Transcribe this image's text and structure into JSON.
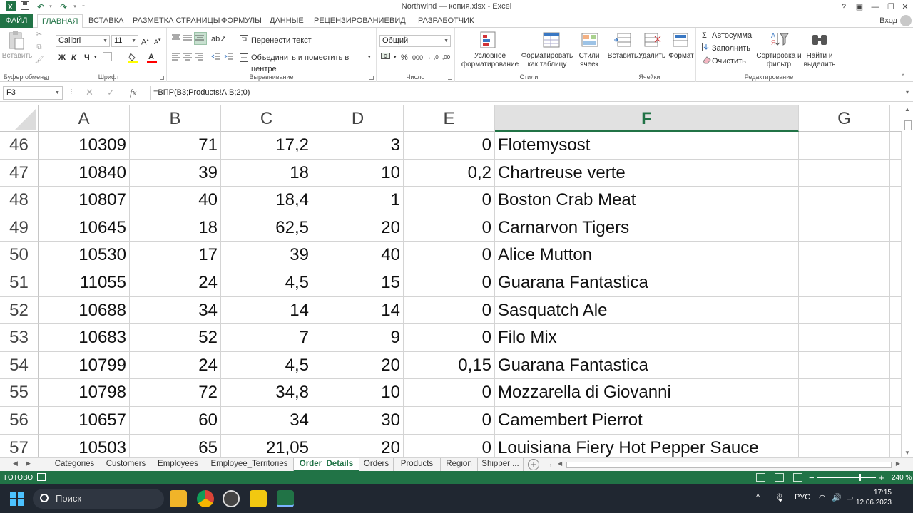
{
  "window": {
    "title": "Northwind — копия.xlsx - Excel",
    "help": "?",
    "login": "Вход"
  },
  "tabs": [
    "ФАЙЛ",
    "ГЛАВНАЯ",
    "ВСТАВКА",
    "РАЗМЕТКА СТРАНИЦЫ",
    "ФОРМУЛЫ",
    "ДАННЫЕ",
    "РЕЦЕНЗИРОВАНИЕ",
    "ВИД",
    "РАЗРАБОТЧИК"
  ],
  "ribbon": {
    "clipboard": {
      "label": "Буфер обмена",
      "paste": "Вставить"
    },
    "font": {
      "label": "Шрифт",
      "name": "Calibri",
      "size": "11",
      "bold": "Ж",
      "italic": "К",
      "underline": "Ч"
    },
    "alignment": {
      "label": "Выравнивание",
      "wrap": "Перенести текст",
      "merge": "Объединить и поместить в центре"
    },
    "number": {
      "label": "Число",
      "format": "Общий",
      "percent": "%",
      "thousands": "000"
    },
    "styles": {
      "label": "Стили",
      "conditional": "Условное форматирование",
      "as_table": "Форматировать как таблицу",
      "cell_styles": "Стили ячеек"
    },
    "cells": {
      "label": "Ячейки",
      "insert": "Вставить",
      "delete": "Удалить",
      "format": "Формат"
    },
    "editing": {
      "label": "Редактирование",
      "autosum": "Автосумма",
      "fill": "Заполнить",
      "clear": "Очистить",
      "sort": "Сортировка и фильтр",
      "find": "Найти и выделить"
    }
  },
  "formula_bar": {
    "name_box": "F3",
    "fx": "fx",
    "formula": "=ВПР(B3;Products!A:B;2;0)"
  },
  "columns": [
    "A",
    "B",
    "C",
    "D",
    "E",
    "F",
    "G"
  ],
  "rows": [
    {
      "n": "46",
      "a": "10309",
      "b": "71",
      "c": "17,2",
      "d": "3",
      "e": "0",
      "f": "Flotemysost"
    },
    {
      "n": "47",
      "a": "10840",
      "b": "39",
      "c": "18",
      "d": "10",
      "e": "0,2",
      "f": "Chartreuse verte"
    },
    {
      "n": "48",
      "a": "10807",
      "b": "40",
      "c": "18,4",
      "d": "1",
      "e": "0",
      "f": "Boston Crab Meat"
    },
    {
      "n": "49",
      "a": "10645",
      "b": "18",
      "c": "62,5",
      "d": "20",
      "e": "0",
      "f": "Carnarvon Tigers"
    },
    {
      "n": "50",
      "a": "10530",
      "b": "17",
      "c": "39",
      "d": "40",
      "e": "0",
      "f": "Alice Mutton"
    },
    {
      "n": "51",
      "a": "11055",
      "b": "24",
      "c": "4,5",
      "d": "15",
      "e": "0",
      "f": "Guarana Fantastica"
    },
    {
      "n": "52",
      "a": "10688",
      "b": "34",
      "c": "14",
      "d": "14",
      "e": "0",
      "f": "Sasquatch Ale"
    },
    {
      "n": "53",
      "a": "10683",
      "b": "52",
      "c": "7",
      "d": "9",
      "e": "0",
      "f": "Filo Mix"
    },
    {
      "n": "54",
      "a": "10799",
      "b": "24",
      "c": "4,5",
      "d": "20",
      "e": "0,15",
      "f": "Guarana Fantastica"
    },
    {
      "n": "55",
      "a": "10798",
      "b": "72",
      "c": "34,8",
      "d": "10",
      "e": "0",
      "f": "Mozzarella di Giovanni"
    },
    {
      "n": "56",
      "a": "10657",
      "b": "60",
      "c": "34",
      "d": "30",
      "e": "0",
      "f": "Camembert Pierrot"
    },
    {
      "n": "57",
      "a": "10503",
      "b": "65",
      "c": "21,05",
      "d": "20",
      "e": "0",
      "f": "Louisiana Fiery Hot Pepper Sauce"
    }
  ],
  "sheets": [
    "Categories",
    "Customers",
    "Employees",
    "Employee_Territories",
    "Order_Details",
    "Orders",
    "Products",
    "Region",
    "Shipper ..."
  ],
  "active_sheet": "Order_Details",
  "status": {
    "ready": "ГОТОВО",
    "zoom": "240 %"
  },
  "taskbar": {
    "search": "Поиск",
    "lang": "РУС",
    "time": "17:15",
    "date": "12.06.2023"
  },
  "colors": {
    "accent": "#217346",
    "taskbar": "#202731"
  }
}
